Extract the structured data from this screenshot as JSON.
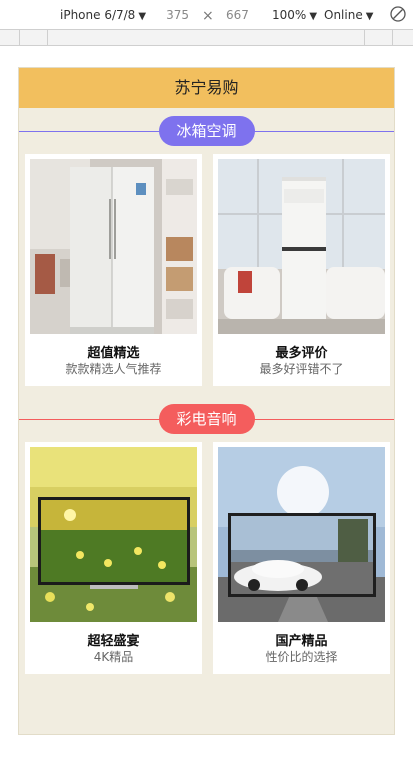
{
  "devtools": {
    "device": "iPhone 6/7/8",
    "width": "375",
    "times": "×",
    "height": "667",
    "zoom": "100%",
    "network": "Online"
  },
  "header": {
    "title": "苏宁易购"
  },
  "colors": {
    "header_bg": "#f2bf5e",
    "page_bg": "#f1ede0",
    "section1_accent": "#7e72ee",
    "section2_accent": "#f45d5d"
  },
  "sections": [
    {
      "title": "冰箱空调",
      "products": [
        {
          "title": "超值精选",
          "subtitle": "款款精选人气推荐",
          "image": "refrigerator-photo"
        },
        {
          "title": "最多评价",
          "subtitle": "最多好评错不了",
          "image": "air-conditioner-photo"
        }
      ]
    },
    {
      "title": "彩电音响",
      "products": [
        {
          "title": "超轻盛宴",
          "subtitle": "4K精品",
          "image": "tv-flowers-photo"
        },
        {
          "title": "国产精品",
          "subtitle": "性价比的选择",
          "image": "tv-car-photo"
        }
      ]
    }
  ]
}
